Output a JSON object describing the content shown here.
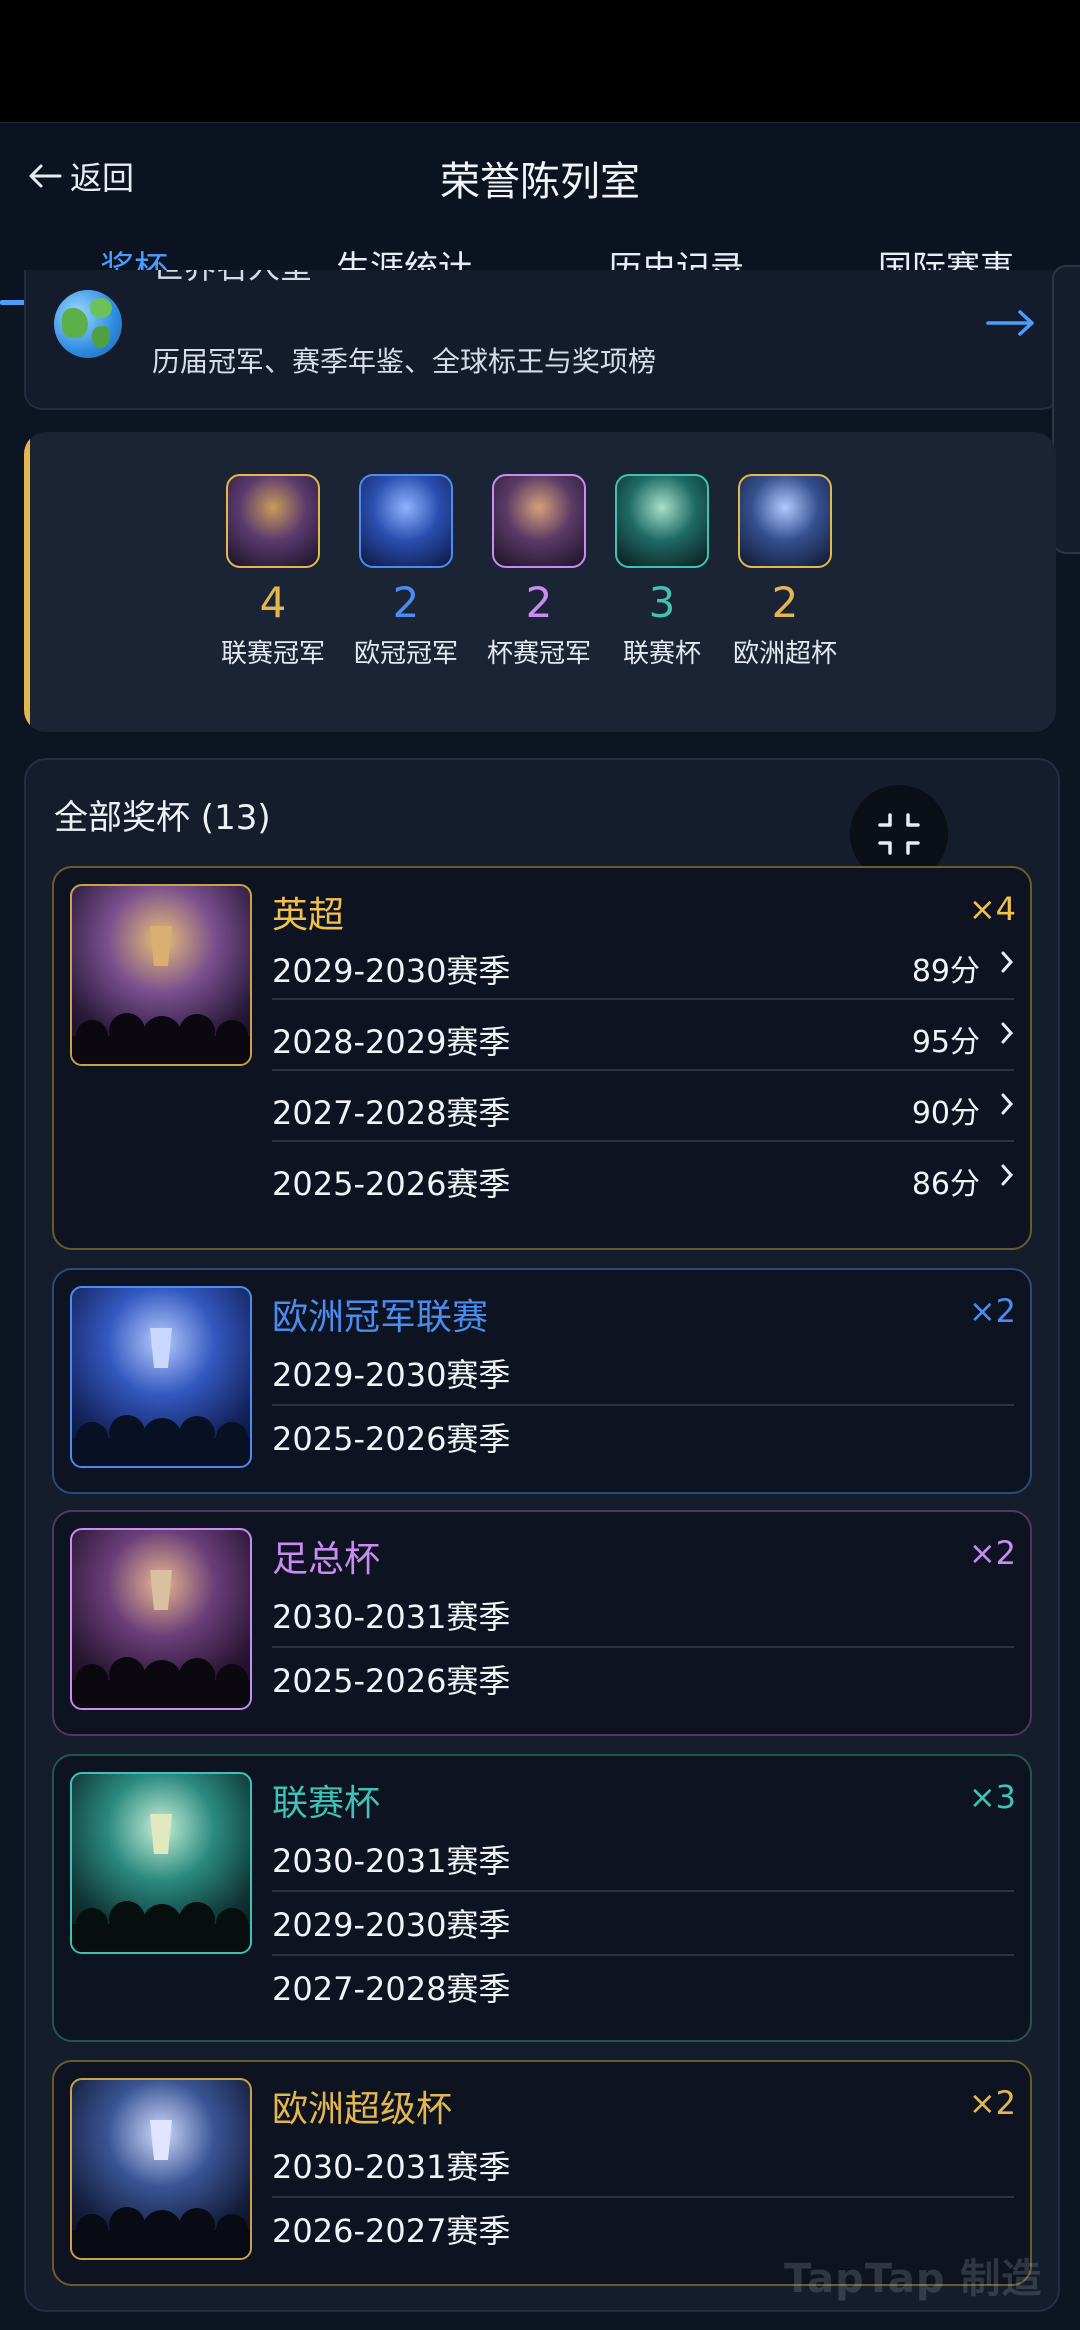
{
  "header": {
    "back_label": "返回",
    "title": "荣誉陈列室"
  },
  "tabs": [
    {
      "label": "奖杯",
      "active": true
    },
    {
      "label": "生涯统计",
      "active": false
    },
    {
      "label": "历史记录",
      "active": false
    },
    {
      "label": "国际赛事",
      "active": false
    }
  ],
  "hall_of_fame": {
    "title": "世界名人堂",
    "subtitle": "历届冠军、赛季年鉴、全球标王与奖项榜",
    "icon": "globe-icon",
    "arrow_icon": "arrow-right-icon"
  },
  "summary": [
    {
      "count": "4",
      "label": "联赛冠军",
      "color": "#e3b64e"
    },
    {
      "count": "2",
      "label": "欧冠冠军",
      "color": "#4a8cf0"
    },
    {
      "count": "2",
      "label": "杯赛冠军",
      "color": "#c98cf0"
    },
    {
      "count": "3",
      "label": "联赛杯",
      "color": "#3fc2b4"
    },
    {
      "count": "2",
      "label": "欧洲超杯",
      "color": "#e3b64e"
    }
  ],
  "all_trophies": {
    "title": "全部奖杯 (13)",
    "collapse_icon": "collapse-icon",
    "groups": [
      {
        "name": "英超",
        "multiplier": "×4",
        "color": "#f0c14a",
        "seasons": [
          {
            "season": "2029-2030赛季",
            "points": "89分"
          },
          {
            "season": "2028-2029赛季",
            "points": "95分"
          },
          {
            "season": "2027-2028赛季",
            "points": "90分"
          },
          {
            "season": "2025-2026赛季",
            "points": "86分"
          }
        ]
      },
      {
        "name": "欧洲冠军联赛",
        "multiplier": "×2",
        "color": "#4a8cf0",
        "seasons": [
          {
            "season": "2029-2030赛季"
          },
          {
            "season": "2025-2026赛季"
          }
        ]
      },
      {
        "name": "足总杯",
        "multiplier": "×2",
        "color": "#c98cf0",
        "seasons": [
          {
            "season": "2030-2031赛季"
          },
          {
            "season": "2025-2026赛季"
          }
        ]
      },
      {
        "name": "联赛杯",
        "multiplier": "×3",
        "color": "#3fc2b4",
        "seasons": [
          {
            "season": "2030-2031赛季"
          },
          {
            "season": "2029-2030赛季"
          },
          {
            "season": "2027-2028赛季"
          }
        ]
      },
      {
        "name": "欧洲超级杯",
        "multiplier": "×2",
        "color": "#e3b64e",
        "seasons": [
          {
            "season": "2030-2031赛季"
          },
          {
            "season": "2026-2027赛季"
          }
        ]
      }
    ]
  },
  "watermark": "TapTap 制造"
}
